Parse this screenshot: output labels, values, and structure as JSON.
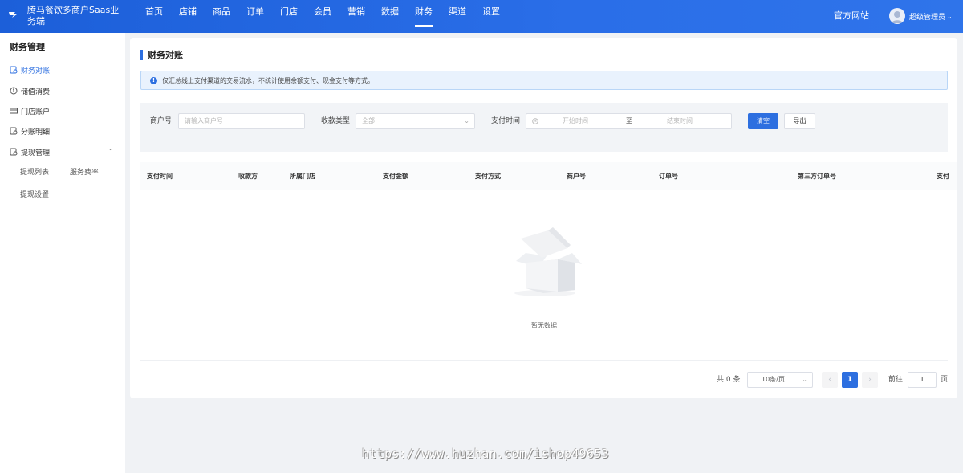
{
  "app": {
    "brand": "腾马餐饮多商户Saas业务端",
    "site_link": "官方网站",
    "user_name": "超级管理员"
  },
  "nav": [
    "首页",
    "店铺",
    "商品",
    "订单",
    "门店",
    "会员",
    "营销",
    "数据",
    "财务",
    "渠道",
    "设置"
  ],
  "nav_active": "财务",
  "sidebar": {
    "title": "财务管理",
    "items": [
      {
        "label": "财务对账",
        "icon": "ledger-icon",
        "active": true
      },
      {
        "label": "储值消费",
        "icon": "coin-icon"
      },
      {
        "label": "门店账户",
        "icon": "card-icon"
      },
      {
        "label": "分账明细",
        "icon": "ledger-icon"
      },
      {
        "label": "提现管理",
        "icon": "wallet-icon"
      }
    ],
    "sub_items": [
      "提现列表",
      "服务费率",
      "提现设置"
    ]
  },
  "page": {
    "title": "财务对账",
    "alert": "仅汇总线上支付渠道的交易流水，不统计使用余额支付、现金支付等方式。"
  },
  "filters": {
    "merchant_label": "商户号",
    "merchant_placeholder": "请输入商户号",
    "type_label": "收款类型",
    "type_value": "全部",
    "time_label": "支付时间",
    "start_placeholder": "开始时间",
    "range_sep": "至",
    "end_placeholder": "结束时间",
    "clear_label": "清空",
    "export_label": "导出"
  },
  "table": {
    "columns": [
      "支付时间",
      "收款方",
      "所属门店",
      "支付金额",
      "支付方式",
      "商户号",
      "订单号",
      "第三方订单号",
      "支付"
    ],
    "empty_text": "暂无数据"
  },
  "pagination": {
    "total": "共 0 条",
    "page_size": "10条/页",
    "current_page": "1",
    "goto_label": "前往",
    "goto_value": "1",
    "goto_unit": "页"
  },
  "watermark": "https://www.huzhan.com/ishop49653",
  "colors": {
    "primary": "#2d6fe0",
    "topbar": "#2a6ee8",
    "alert_bg": "#e9f2fd"
  }
}
